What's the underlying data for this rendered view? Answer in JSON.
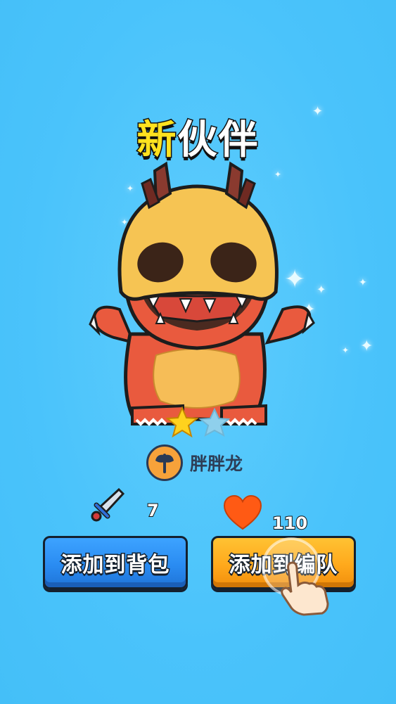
{
  "screen": {
    "title_highlight": "新",
    "title_rest": "伙伴"
  },
  "pet": {
    "name": "胖胖龙",
    "stars_filled": 1,
    "stars_total": 2,
    "class_icon": "axe-icon",
    "character": "red-horned-monster"
  },
  "stats": {
    "attack": {
      "icon": "sword-icon",
      "value": "7"
    },
    "health": {
      "icon": "heart-icon",
      "value": "110"
    }
  },
  "buttons": {
    "add_to_bag": "添加到背包",
    "add_to_team": "添加到编队"
  },
  "tutorial": {
    "pointer_icon": "tap-hand-icon"
  },
  "colors": {
    "background": "#4ac3fb",
    "title_accent": "#ffe21f",
    "bag_button": "#2a8cf2",
    "team_button": "#ffa91c",
    "star_filled": "#ffd21e",
    "star_empty": "#8fd0ec",
    "heart": "#ff5a14"
  }
}
